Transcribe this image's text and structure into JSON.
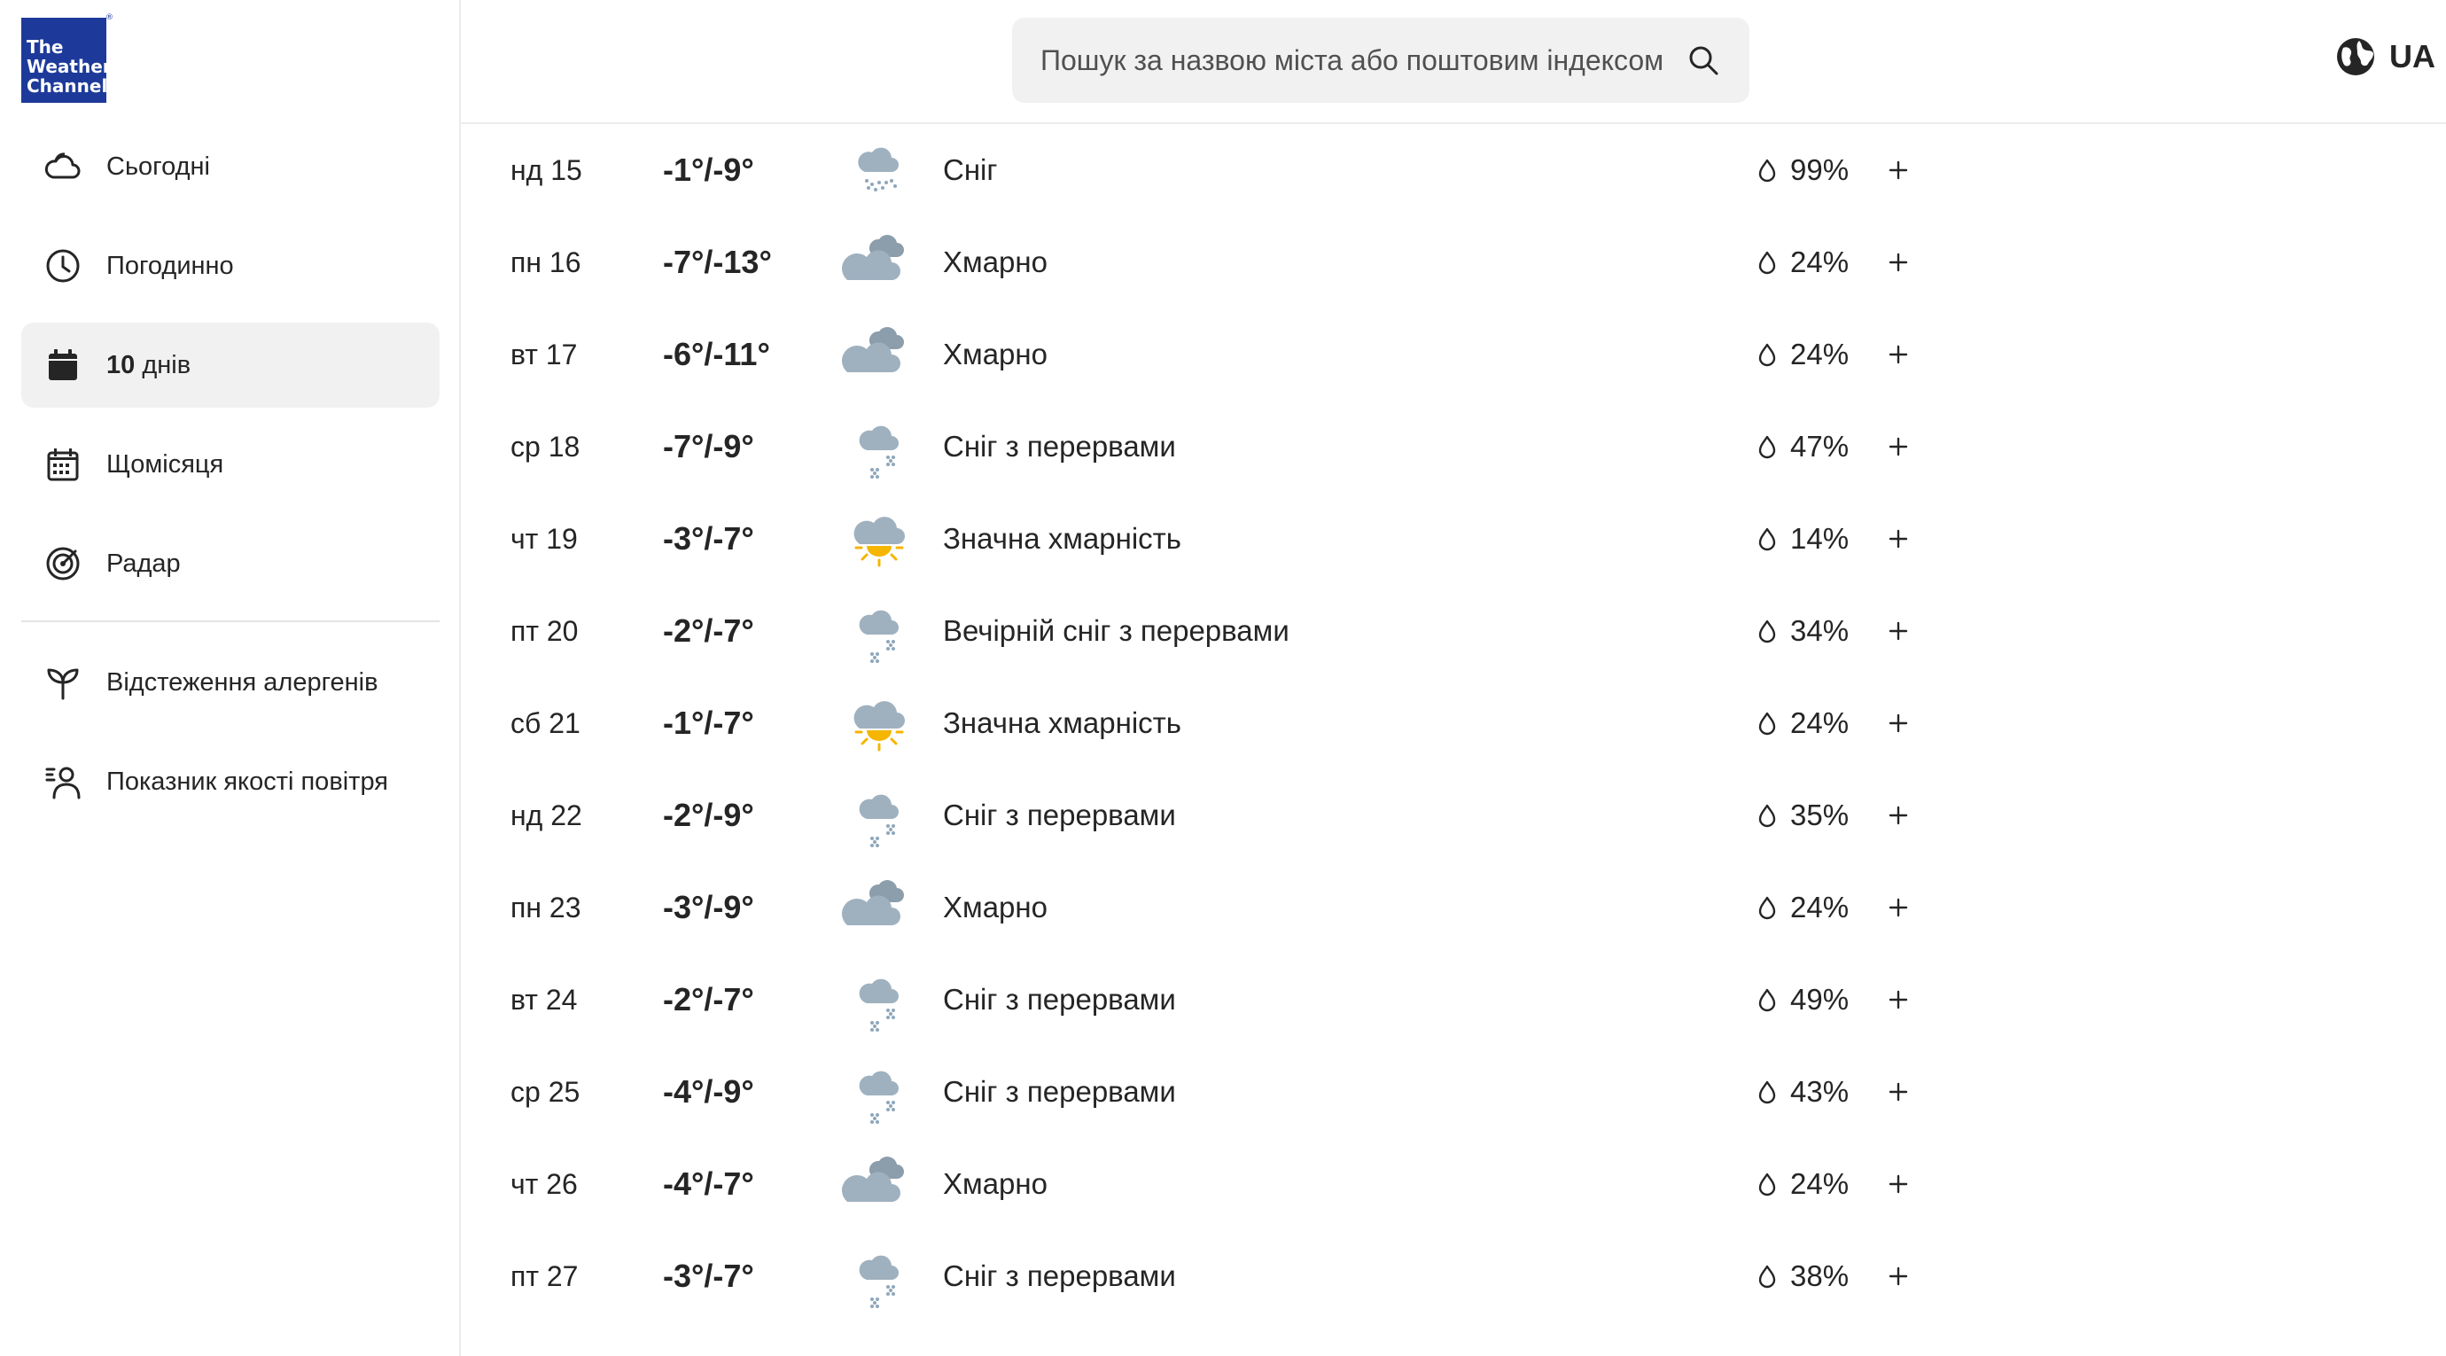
{
  "logo": {
    "line1": "The",
    "line2": "Weather",
    "line3": "Channel",
    "mark": "®",
    "color": "#1d3a9a"
  },
  "sidebar": {
    "items": [
      {
        "label": "Сьогодні",
        "icon": "cloud-icon"
      },
      {
        "label": "Погодинно",
        "icon": "clock-icon"
      },
      {
        "label_bold": "10",
        "label_rest": " днів",
        "icon": "calendar-icon",
        "active": true
      },
      {
        "label": "Щомісяця",
        "icon": "calendar-grid-icon"
      },
      {
        "label": "Радар",
        "icon": "radar-icon"
      }
    ],
    "extra_items": [
      {
        "label": "Відстеження алергенів",
        "icon": "sprout-icon"
      },
      {
        "label": "Показник якості повітря",
        "icon": "person-air-icon"
      }
    ]
  },
  "header": {
    "search": {
      "placeholder": "Пошук за назвою міста або поштовим індексом"
    },
    "language": {
      "label": "UA",
      "icon": "globe-icon"
    }
  },
  "forecast": [
    {
      "day": "нд 15",
      "temps": "-1°/-9°",
      "icon": "snow",
      "condition": "Сніг",
      "precip": "99%"
    },
    {
      "day": "пн 16",
      "temps": "-7°/-13°",
      "icon": "cloudy",
      "condition": "Хмарно",
      "precip": "24%"
    },
    {
      "day": "вт 17",
      "temps": "-6°/-11°",
      "icon": "cloudy",
      "condition": "Хмарно",
      "precip": "24%"
    },
    {
      "day": "ср 18",
      "temps": "-7°/-9°",
      "icon": "scattered-snow",
      "condition": "Сніг з перервами",
      "precip": "47%"
    },
    {
      "day": "чт 19",
      "temps": "-3°/-7°",
      "icon": "mostly-cloudy",
      "condition": "Значна хмарність",
      "precip": "14%"
    },
    {
      "day": "пт 20",
      "temps": "-2°/-7°",
      "icon": "scattered-snow",
      "condition": "Вечірній сніг з перервами",
      "precip": "34%"
    },
    {
      "day": "сб 21",
      "temps": "-1°/-7°",
      "icon": "mostly-cloudy",
      "condition": "Значна хмарність",
      "precip": "24%"
    },
    {
      "day": "нд 22",
      "temps": "-2°/-9°",
      "icon": "scattered-snow",
      "condition": "Сніг з перервами",
      "precip": "35%"
    },
    {
      "day": "пн 23",
      "temps": "-3°/-9°",
      "icon": "cloudy",
      "condition": "Хмарно",
      "precip": "24%"
    },
    {
      "day": "вт 24",
      "temps": "-2°/-7°",
      "icon": "scattered-snow",
      "condition": "Сніг з перервами",
      "precip": "49%"
    },
    {
      "day": "ср 25",
      "temps": "-4°/-9°",
      "icon": "scattered-snow",
      "condition": "Сніг з перервами",
      "precip": "43%"
    },
    {
      "day": "чт 26",
      "temps": "-4°/-7°",
      "icon": "cloudy",
      "condition": "Хмарно",
      "precip": "24%"
    },
    {
      "day": "пт 27",
      "temps": "-3°/-7°",
      "icon": "scattered-snow",
      "condition": "Сніг з перервами",
      "precip": "38%"
    }
  ],
  "colors": {
    "cloud": "#9fb1bf",
    "cloud_dark": "#8c9dab",
    "snow": "#8fa7bb",
    "sun": "#f5b500",
    "accent_bg": "#f1f1f1"
  }
}
